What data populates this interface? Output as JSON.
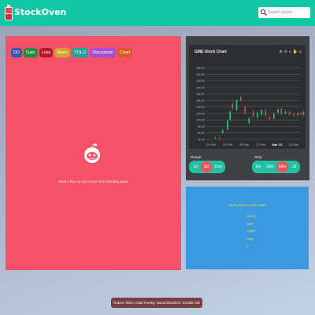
{
  "app": {
    "brand": "StockOven",
    "search_placeholder": "Search stocks"
  },
  "filters": [
    {
      "label": "DD",
      "color": "#3a55a8"
    },
    {
      "label": "Gain",
      "color": "#1f8f3a"
    },
    {
      "label": "Loss",
      "color": "#b31b2a"
    },
    {
      "label": "News",
      "color": "#d4a12a"
    },
    {
      "label": "YOLO",
      "color": "#1aa7a0"
    },
    {
      "label": "Discussion",
      "color": "#a44fd0"
    },
    {
      "label": "Chart",
      "color": "#e2571c"
    }
  ],
  "main": {
    "hint": "Click a flair up top to see their trending posts"
  },
  "chart": {
    "title": "GME Stock Chart",
    "tools": [
      "zoom-in-icon",
      "zoom-out-icon",
      "zoom-selection-icon",
      "pan-icon",
      "home-icon"
    ],
    "range_label": "Range:",
    "step_label": "Step:",
    "range_buttons": [
      {
        "label": "1d",
        "active": false
      },
      {
        "label": "5d",
        "active": true
      },
      {
        "label": "1mo",
        "active": false
      }
    ],
    "step_buttons": [
      {
        "label": "5m",
        "active": false
      },
      {
        "label": "15m",
        "active": false
      },
      {
        "label": "60m",
        "active": true
      },
      {
        "label": "1d",
        "active": false
      }
    ],
    "colors": {
      "background": "#2c2e31",
      "up": "#2ecc71",
      "down": "#e74c3c",
      "grid": "#6b6e73"
    }
  },
  "chart_data": {
    "type": "candlestick",
    "title": "GME Stock Chart",
    "y_ticks": [
      260,
      240,
      220,
      200,
      180,
      160,
      140,
      120,
      100,
      80,
      60,
      40
    ],
    "x_ticks": [
      "24 Feb",
      "25 Feb",
      "26 Feb",
      "27 Feb",
      "Mar '21",
      "02 Mar"
    ],
    "ylim": [
      40,
      260
    ],
    "candles": [
      {
        "x": 0.25,
        "o": 44,
        "c": 46
      },
      {
        "x": 0.5,
        "o": 45,
        "c": 44
      },
      {
        "x": 0.7,
        "o": 60,
        "c": 68
      },
      {
        "x": 1.0,
        "o": 70,
        "c": 98
      },
      {
        "x": 1.15,
        "o": 100,
        "c": 125
      },
      {
        "x": 1.3,
        "o": 150,
        "c": 135
      },
      {
        "x": 1.55,
        "o": 130,
        "c": 160
      },
      {
        "x": 1.8,
        "o": 170,
        "c": 158
      },
      {
        "x": 2.05,
        "o": 140,
        "c": 120
      },
      {
        "x": 2.3,
        "o": 90,
        "c": 105
      },
      {
        "x": 2.55,
        "o": 125,
        "c": 112
      },
      {
        "x": 2.8,
        "o": 108,
        "c": 122
      },
      {
        "x": 3.05,
        "o": 115,
        "c": 130
      },
      {
        "x": 3.3,
        "o": 130,
        "c": 112
      },
      {
        "x": 3.55,
        "o": 108,
        "c": 102
      },
      {
        "x": 3.8,
        "o": 104,
        "c": 118
      },
      {
        "x": 4.05,
        "o": 122,
        "c": 132
      },
      {
        "x": 4.25,
        "o": 134,
        "c": 118
      },
      {
        "x": 4.5,
        "o": 120,
        "c": 126
      },
      {
        "x": 4.75,
        "o": 124,
        "c": 116
      },
      {
        "x": 5.0,
        "o": 118,
        "c": 112
      },
      {
        "x": 5.25,
        "o": 114,
        "c": 120
      },
      {
        "x": 5.45,
        "o": 122,
        "c": 116
      },
      {
        "x": 5.6,
        "o": 116,
        "c": 124
      }
    ]
  },
  "info": {
    "title": "Most active r/wsb Posts",
    "tickers": [
      "ORCL",
      "RKT",
      "TDRT",
      "PRE",
      "Y"
    ]
  },
  "footer": {
    "text": "Robert Tilton, Isiah Feeley, Navid Ebrahimi, Knobili Yuk"
  }
}
